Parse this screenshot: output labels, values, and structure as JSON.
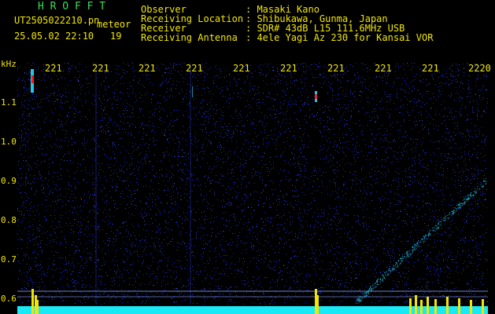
{
  "header": {
    "title": "H R O F F T",
    "file_name": "UT2505022210.pn",
    "mode": "meteor",
    "datetime": "25.05.02 22:10",
    "count": "19",
    "fields": [
      {
        "label": "Observer",
        "value": ": Masaki Kano"
      },
      {
        "label": "Receiving Location",
        "value": ": Shibukawa, Gunma, Japan"
      },
      {
        "label": "Receiver",
        "value": ": SDR# 43dB L15 111.6MHz USB"
      },
      {
        "label": "Receiving Antenna",
        "value": ": 4ele Yagi Az 230 for Kansai VOR"
      }
    ]
  },
  "chart_data": {
    "type": "heatmap",
    "ylabel": "kHz",
    "y_ticks": [
      "1.1",
      "1.0",
      "0.9",
      "0.8",
      "0.7",
      "0.6"
    ],
    "x_ticks": [
      "221",
      "221",
      "221",
      "221",
      "221",
      "221",
      "221",
      "221",
      "221",
      "2220"
    ],
    "colors": {
      "background": "#000000",
      "noise": "#1a2bd6",
      "signal_low": "#22c6e6",
      "signal_high": "#e8202a",
      "baseline": "#19e8f5",
      "labels": "#f2e600",
      "title": "#3ddc5a"
    }
  }
}
